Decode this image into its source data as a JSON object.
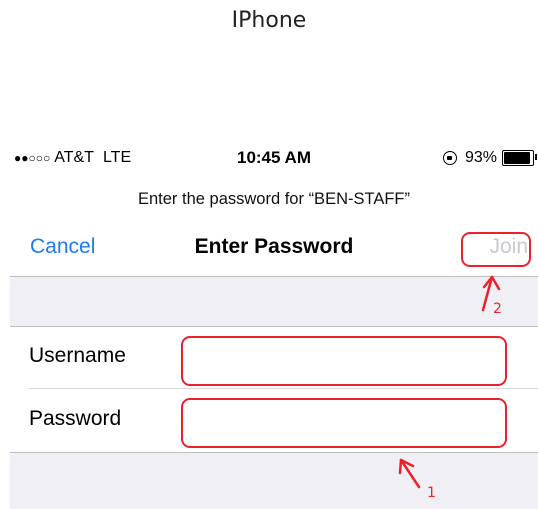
{
  "caption": "IPhone",
  "status_bar": {
    "signal_dots": "●●○○○",
    "carrier": "AT&T",
    "network": "LTE",
    "time": "10:45 AM",
    "battery": "93%"
  },
  "prompt": "Enter the password for “BEN-STAFF”",
  "nav": {
    "cancel_label": "Cancel",
    "title": "Enter Password",
    "join_label": "Join"
  },
  "form": {
    "fields": [
      {
        "label": "Username",
        "value": ""
      },
      {
        "label": "Password",
        "value": ""
      }
    ]
  },
  "annotations": {
    "step_1": "1",
    "step_2": "2",
    "color": "#e8232b"
  },
  "colors": {
    "accent": "#1e7cf2",
    "disabled": "#c9c9ce",
    "grouped_background": "#efeff4"
  },
  "icons": [
    "orientation-lock-icon",
    "battery-icon"
  ]
}
